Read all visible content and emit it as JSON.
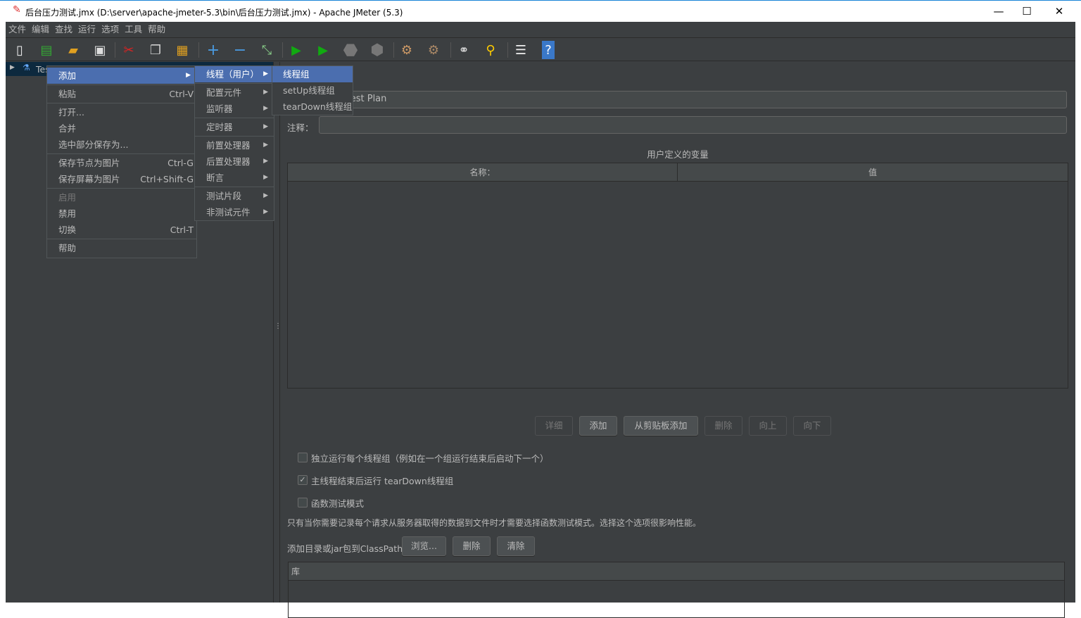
{
  "window": {
    "title": "后台压力测试.jmx (D:\\server\\apache-jmeter-5.3\\bin\\后台压力测试.jmx) - Apache JMeter (5.3)",
    "minimize": "—",
    "maximize": "☐",
    "close": "✕"
  },
  "menubar": [
    "文件",
    "编辑",
    "查找",
    "运行",
    "选项",
    "工具",
    "帮助"
  ],
  "toolbar": [
    "new-icon",
    "templates-icon",
    "open-icon",
    "save-icon",
    "cut-icon",
    "copy-icon",
    "paste-icon",
    "expand-icon",
    "collapse-icon",
    "toggle-icon",
    "start-icon",
    "start-no-pause-icon",
    "stop-icon",
    "shutdown-icon",
    "clear-icon",
    "clear-all-icon",
    "search-icon",
    "reset-search-icon",
    "function-helper-icon",
    "help-icon"
  ],
  "tree": {
    "root": "Test Plan"
  },
  "context_menu": {
    "items": [
      {
        "label": "添加",
        "submenu": true,
        "highlighted": true
      },
      {
        "label": "粘贴",
        "shortcut": "Ctrl-V"
      },
      {
        "label": "打开..."
      },
      {
        "label": "合并"
      },
      {
        "label": "选中部分保存为..."
      },
      {
        "label": "保存节点为图片",
        "shortcut": "Ctrl-G"
      },
      {
        "label": "保存屏幕为图片",
        "shortcut": "Ctrl+Shift-G"
      },
      {
        "label": "启用",
        "disabled": true
      },
      {
        "label": "禁用"
      },
      {
        "label": "切换",
        "shortcut": "Ctrl-T"
      },
      {
        "label": "帮助"
      }
    ]
  },
  "add_submenu": [
    "线程（用户）",
    "配置元件",
    "监听器",
    "定时器",
    "前置处理器",
    "后置处理器",
    "断言",
    "测试片段",
    "非测试元件"
  ],
  "thread_submenu": [
    "线程组",
    "setUp线程组",
    "tearDown线程组"
  ],
  "panel": {
    "name_value": "Test Plan",
    "comment_label": "注释：",
    "comment_value": "",
    "variables_title": "用户定义的变量",
    "columns": [
      "名称：",
      "值"
    ],
    "buttons": [
      "详细",
      "添加",
      "从剪贴板添加",
      "删除",
      "向上",
      "向下"
    ],
    "options": [
      {
        "label": "独立运行每个线程组（例如在一个组运行结束后启动下一个）",
        "checked": false
      },
      {
        "label": "主线程结束后运行 tearDown线程组",
        "checked": true
      },
      {
        "label": "函数测试模式",
        "checked": false
      }
    ],
    "note": "只有当你需要记录每个请求从服务器取得的数据到文件时才需要选择函数测试模式。选择这个选项很影响性能。",
    "classpath_label": "添加目录或jar包到ClassPath",
    "classpath_buttons": [
      "浏览...",
      "删除",
      "清除"
    ],
    "library_header": "库"
  },
  "colors": {
    "background": "#3c3f41",
    "highlight": "#4b6eaf",
    "tree_selection": "#0d293e"
  }
}
